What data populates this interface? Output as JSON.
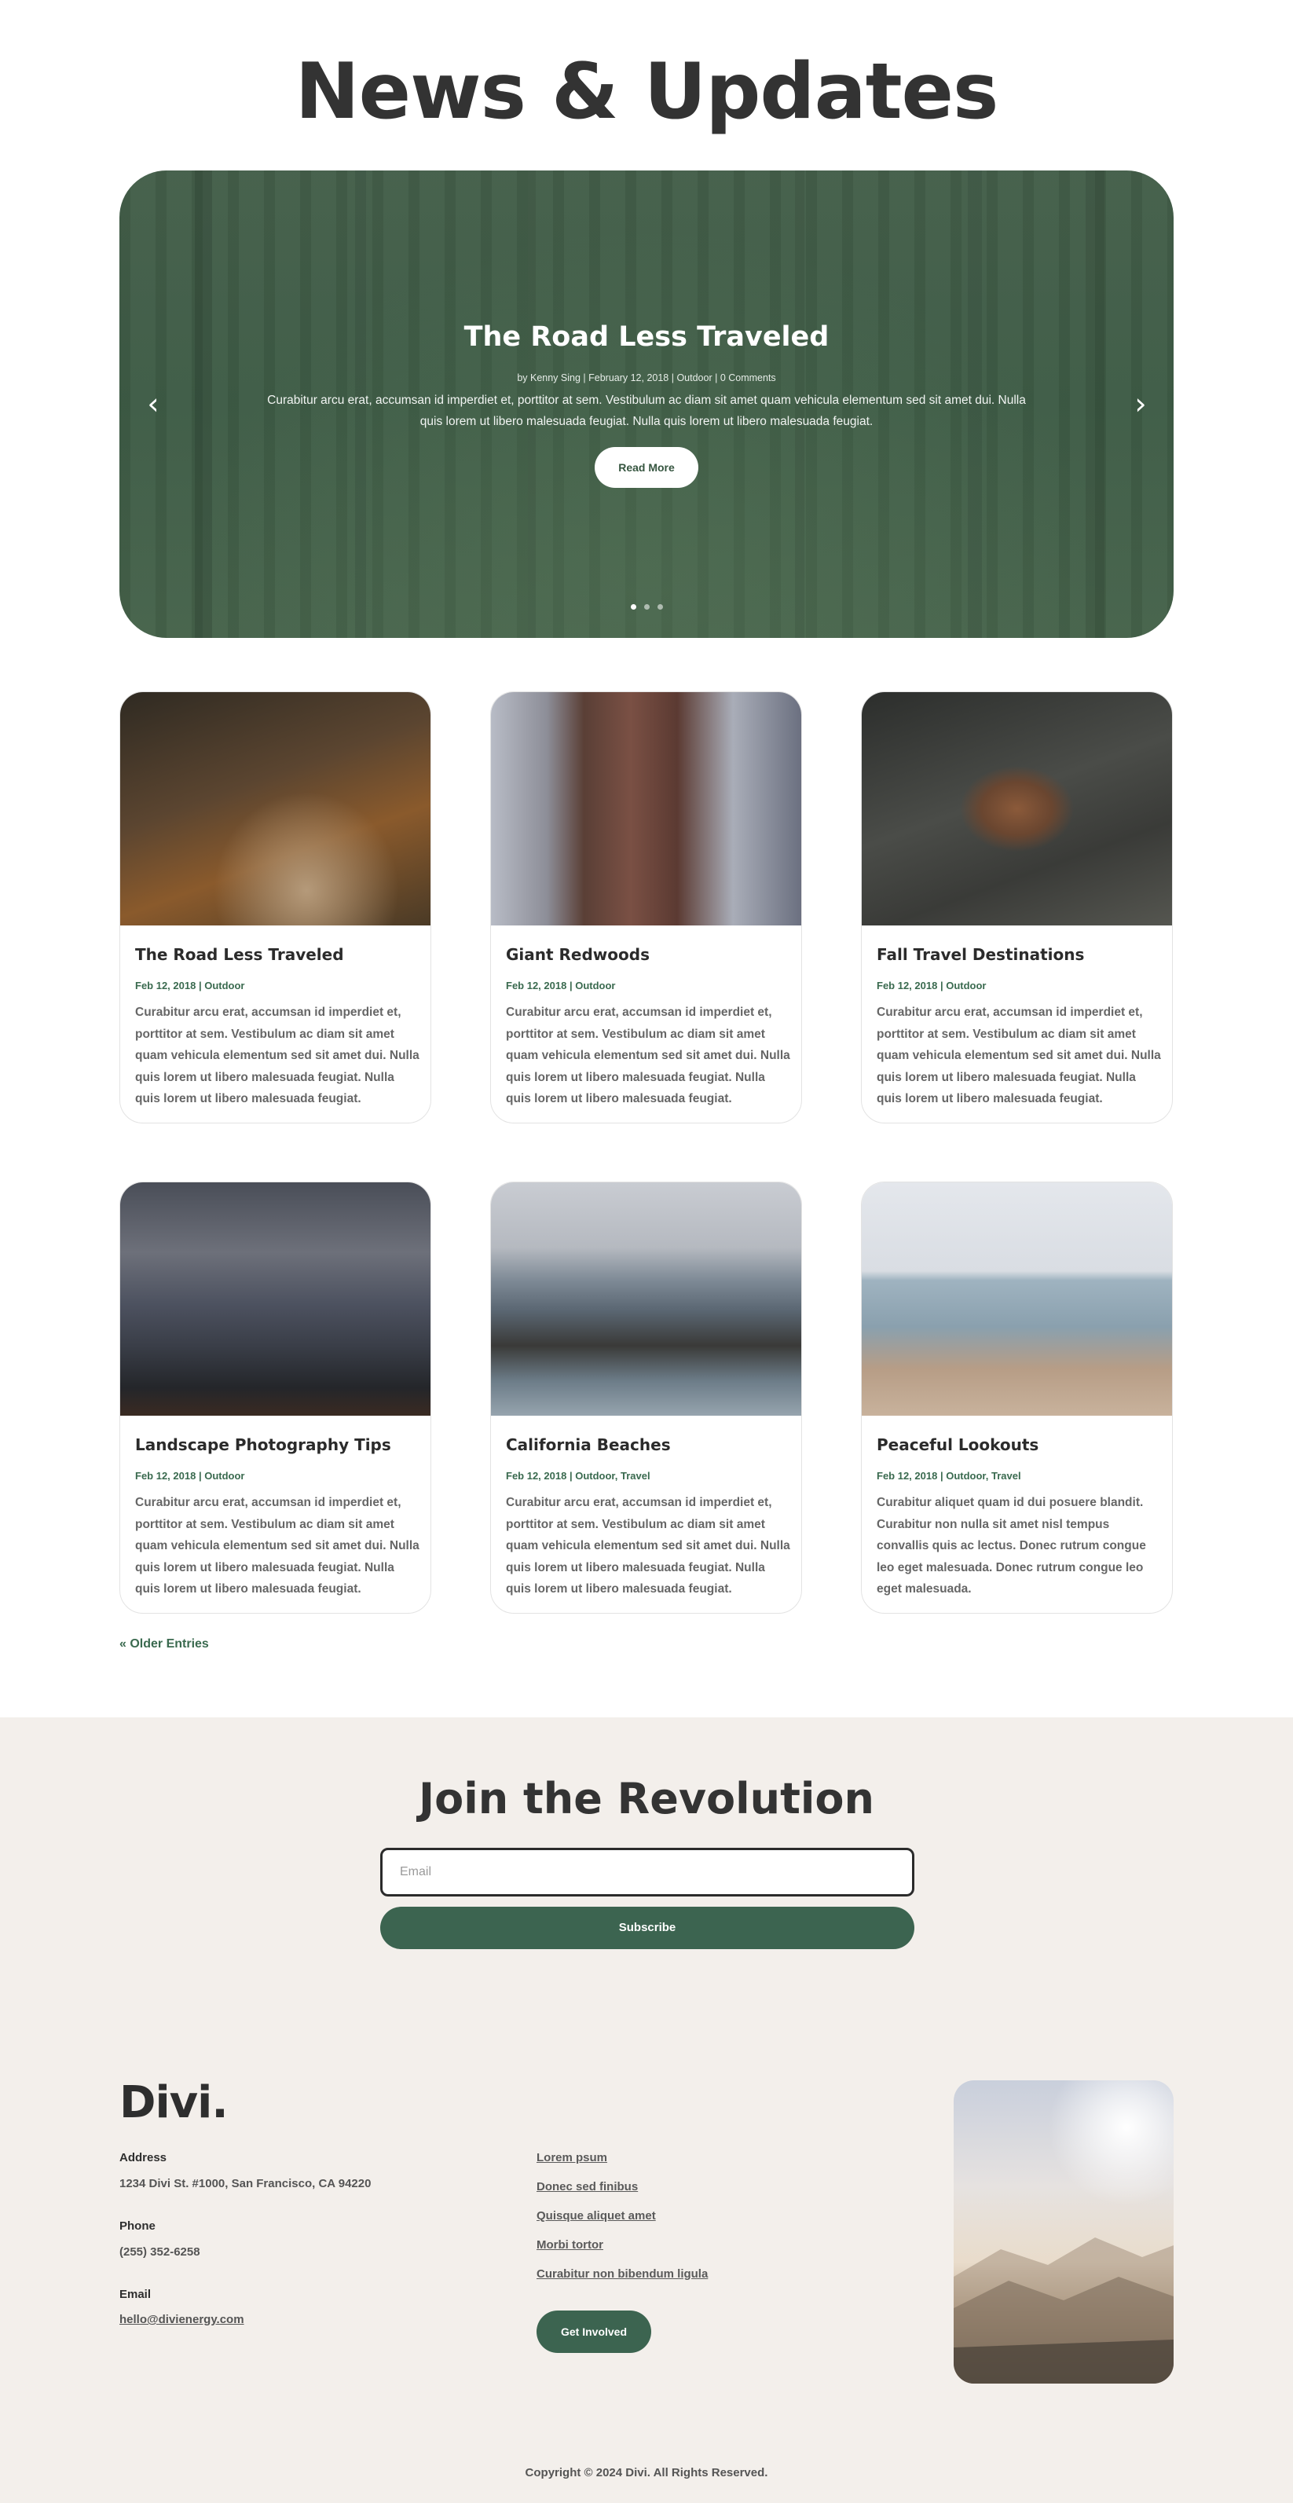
{
  "page": {
    "title": "News & Updates"
  },
  "slider": {
    "title": "The Road Less Traveled",
    "meta": "by Kenny Sing | February 12, 2018 | Outdoor | 0 Comments",
    "excerpt": "Curabitur arcu erat, accumsan id imperdiet et, porttitor at sem. Vestibulum ac diam sit amet quam vehicula elementum sed sit amet dui. Nulla quis lorem ut libero malesuada feugiat. Nulla quis lorem ut libero malesuada feugiat.",
    "button_label": "Read More",
    "prev_icon": "‹",
    "next_icon": "›",
    "slide_count": 3,
    "active_slide": 1
  },
  "posts": [
    {
      "title": "The Road Less Traveled",
      "date": "Feb 12, 2018",
      "categories": "Outdoor",
      "excerpt": "Curabitur arcu erat, accumsan id imperdiet et, porttitor at sem. Vestibulum ac diam sit amet quam vehicula elementum sed sit amet dui. Nulla quis lorem ut libero malesuada feugiat. Nulla quis lorem ut libero malesuada feugiat."
    },
    {
      "title": "Giant Redwoods",
      "date": "Feb 12, 2018",
      "categories": "Outdoor",
      "excerpt": "Curabitur arcu erat, accumsan id imperdiet et, porttitor at sem. Vestibulum ac diam sit amet quam vehicula elementum sed sit amet dui. Nulla quis lorem ut libero malesuada feugiat. Nulla quis lorem ut libero malesuada feugiat."
    },
    {
      "title": "Fall Travel Destinations",
      "date": "Feb 12, 2018",
      "categories": "Outdoor",
      "excerpt": "Curabitur arcu erat, accumsan id imperdiet et, porttitor at sem. Vestibulum ac diam sit amet quam vehicula elementum sed sit amet dui. Nulla quis lorem ut libero malesuada feugiat. Nulla quis lorem ut libero malesuada feugiat."
    },
    {
      "title": "Landscape Photography Tips",
      "date": "Feb 12, 2018",
      "categories": "Outdoor",
      "excerpt": "Curabitur arcu erat, accumsan id imperdiet et, porttitor at sem. Vestibulum ac diam sit amet quam vehicula elementum sed sit amet dui. Nulla quis lorem ut libero malesuada feugiat. Nulla quis lorem ut libero malesuada feugiat."
    },
    {
      "title": "California Beaches",
      "date": "Feb 12, 2018",
      "categories": "Outdoor, Travel",
      "excerpt": "Curabitur arcu erat, accumsan id imperdiet et, porttitor at sem. Vestibulum ac diam sit amet quam vehicula elementum sed sit amet dui. Nulla quis lorem ut libero malesuada feugiat. Nulla quis lorem ut libero malesuada feugiat."
    },
    {
      "title": "Peaceful Lookouts",
      "date": "Feb 12, 2018",
      "categories": "Outdoor, Travel",
      "excerpt": "Curabitur aliquet quam id dui posuere blandit. Curabitur non nulla sit amet nisl tempus convallis quis ac lectus. Donec rutrum congue leo eget malesuada. Donec rutrum congue leo eget malesuada."
    }
  ],
  "pagination": {
    "older_label": "« Older Entries"
  },
  "newsletter": {
    "title": "Join the Revolution",
    "email_placeholder": "Email",
    "email_value": "",
    "subscribe_label": "Subscribe"
  },
  "footer": {
    "logo": "Divi.",
    "address_label": "Address",
    "address_value": "1234 Divi St. #1000, San Francisco, CA 94220",
    "phone_label": "Phone",
    "phone_value": "(255) 352-6258",
    "email_label": "Email",
    "email_value": "hello@divienergy.com",
    "links": [
      "Lorem psum",
      "Donec sed finibus",
      "Quisque aliquet amet",
      "Morbi tortor",
      "Curabitur non bibendum ligula"
    ],
    "cta_label": "Get Involved",
    "copyright": "Copyright © 2024 Divi. All Rights Reserved."
  },
  "colors": {
    "accent": "#3c6450",
    "meta_green": "#3a6a4f",
    "footer_bg": "#f3efeb",
    "heading": "#333333"
  }
}
